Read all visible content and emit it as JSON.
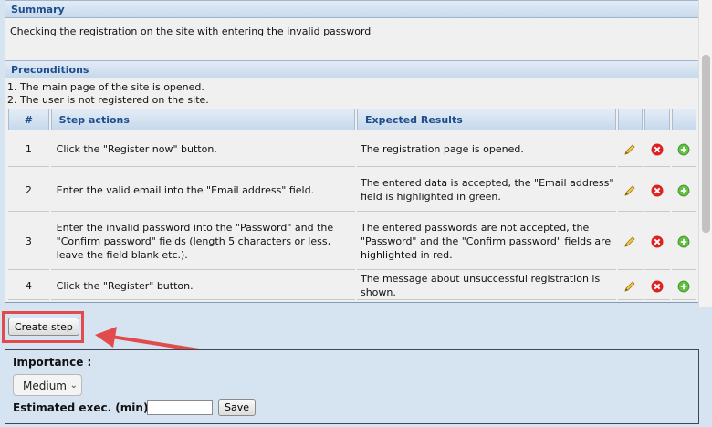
{
  "summary": {
    "header": "Summary",
    "text": "Checking the registration on the site with entering the invalid password"
  },
  "preconditions": {
    "header": "Preconditions",
    "lines": [
      "1. The main page of the site is opened.",
      "2. The user is not registered on the site."
    ]
  },
  "steps_table": {
    "col_num": "#",
    "col_actions": "Step actions",
    "col_expected": "Expected Results",
    "rows": [
      {
        "num": "1",
        "action": "Click the \"Register now\" button.",
        "expected": "The registration page is opened."
      },
      {
        "num": "2",
        "action": "Enter the valid email into the \"Email address\" field.",
        "expected": "The entered data is accepted, the \"Email address\" field is highlighted in green."
      },
      {
        "num": "3",
        "action": "Enter the invalid password into the \"Password\" and the \"Confirm password\" fields (length 5 characters or less, leave the field blank etc.).",
        "expected": "The entered passwords are not accepted, the \"Password\" and the \"Confirm password\" fields are highlighted in red."
      },
      {
        "num": "4",
        "action": "Click the \"Register\" button.",
        "expected": "The message about unsuccessful registration is shown."
      }
    ]
  },
  "create_step_label": "Create step",
  "importance": {
    "label": "Importance :",
    "selected": "Medium"
  },
  "estimated": {
    "label": "Estimated exec. (min) :",
    "value": "",
    "save_label": "Save"
  },
  "icons": [
    "pencil-icon",
    "delete-icon",
    "add-icon"
  ],
  "colors": {
    "highlight": "#e24b4b",
    "header_text": "#1f4e8c"
  }
}
